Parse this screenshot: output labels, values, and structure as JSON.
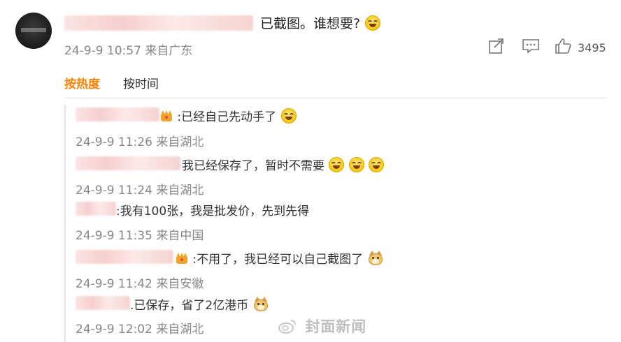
{
  "post": {
    "text": "已截图。谁想要?",
    "time": "24-9-9 10:57",
    "location": "来自广东",
    "like_count": "3495"
  },
  "icons": {
    "share": "share-icon",
    "comment": "comment-icon",
    "like": "thumbs-up-icon"
  },
  "tabs": {
    "hot": "按热度",
    "time": "按时间"
  },
  "replies": [
    {
      "text": ":已经自己先动手了",
      "time": "24-9-9 11:26",
      "location": "来自湖北"
    },
    {
      "text": "我已经保存了，暂时不需要",
      "time": "24-9-9 11:24",
      "location": "来自湖北"
    },
    {
      "text": ":我有100张，我是批发价，先到先得",
      "time": "24-9-9 11:35",
      "location": "来自中国"
    },
    {
      "text": ":不用了，我已经可以自己截图了",
      "time": "24-9-9 11:42",
      "location": "来自安徽"
    },
    {
      "text": ".已保存，省了2亿港币",
      "time": "24-9-9 12:02",
      "location": "来自湖北"
    }
  ],
  "watermark": "封面新闻",
  "colors": {
    "accent": "#ff8200",
    "meta": "#888888"
  }
}
